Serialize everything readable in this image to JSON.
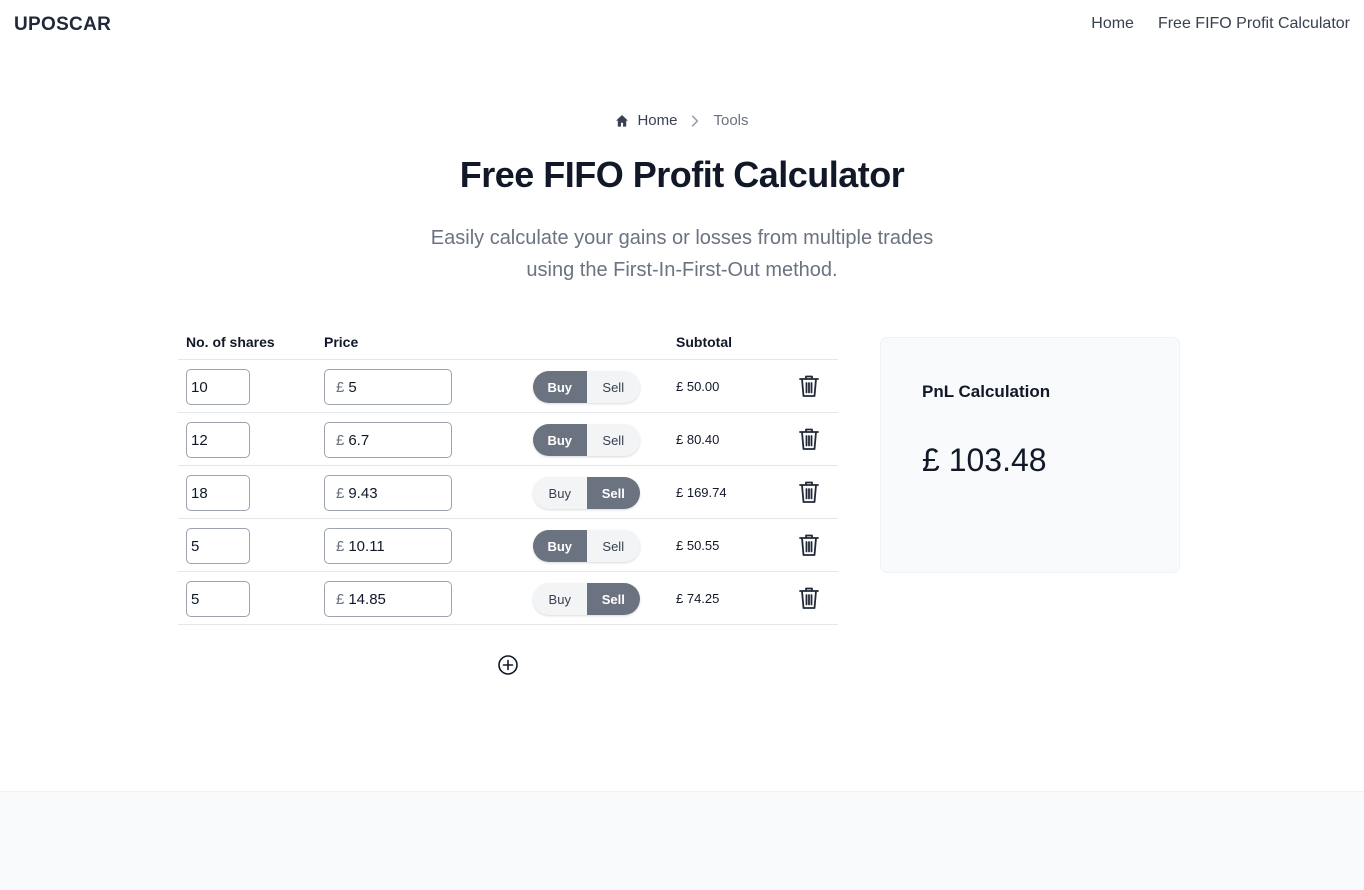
{
  "header": {
    "brand": "UPOSCAR",
    "nav": [
      {
        "label": "Home"
      },
      {
        "label": "Free FIFO Profit Calculator"
      }
    ]
  },
  "breadcrumb": {
    "home_label": "Home",
    "current_label": "Tools",
    "home_icon": "home-icon",
    "separator_icon": "chevron-right-icon"
  },
  "page": {
    "title": "Free FIFO Profit Calculator",
    "subtitle_line1": "Easily calculate your gains or losses from multiple trades",
    "subtitle_line2": "using the First-In-First-Out method."
  },
  "table": {
    "headers": {
      "shares": "No. of shares",
      "price": "Price",
      "subtotal": "Subtotal"
    },
    "currency_symbol": "£",
    "buy_label": "Buy",
    "sell_label": "Sell",
    "delete_icon": "trash-icon",
    "rows": [
      {
        "shares": "10",
        "price": "5",
        "side": "Buy",
        "subtotal": "£ 50.00"
      },
      {
        "shares": "12",
        "price": "6.7",
        "side": "Buy",
        "subtotal": "£ 80.40"
      },
      {
        "shares": "18",
        "price": "9.43",
        "side": "Sell",
        "subtotal": "£ 169.74"
      },
      {
        "shares": "5",
        "price": "10.11",
        "side": "Buy",
        "subtotal": "£ 50.55"
      },
      {
        "shares": "5",
        "price": "14.85",
        "side": "Sell",
        "subtotal": "£ 74.25"
      }
    ],
    "add_icon": "plus-circle-icon"
  },
  "pnl": {
    "label": "PnL Calculation",
    "value": "£ 103.48"
  },
  "colors": {
    "toggle_active": "#6b7280",
    "text_primary": "#111827",
    "text_muted": "#6b7280",
    "card_bg": "#f9fafb"
  }
}
